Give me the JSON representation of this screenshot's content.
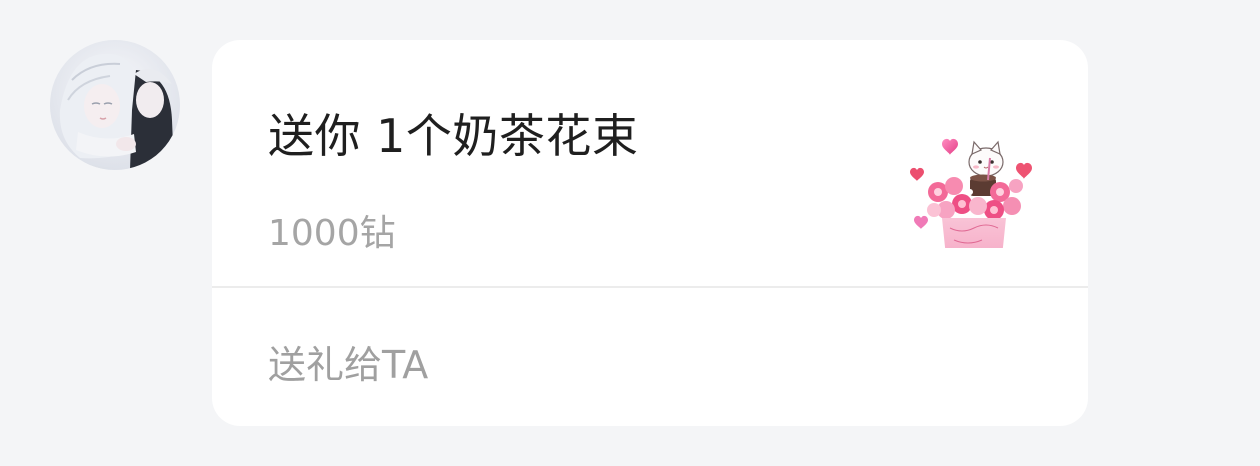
{
  "message": {
    "avatar_icon": "user-avatar-anime-illustration",
    "gift": {
      "title": "送你 1个奶茶花束",
      "price": "1000钻",
      "image_icon": "milk-tea-flower-bouquet-icon"
    },
    "action_label": "送礼给TA"
  },
  "colors": {
    "page_background": "#f4f5f7",
    "card_background": "#ffffff",
    "title_text": "#1f1f1f",
    "secondary_text": "#a5a5a5",
    "divider": "#ececec",
    "accent_pink": "#f0679a"
  }
}
